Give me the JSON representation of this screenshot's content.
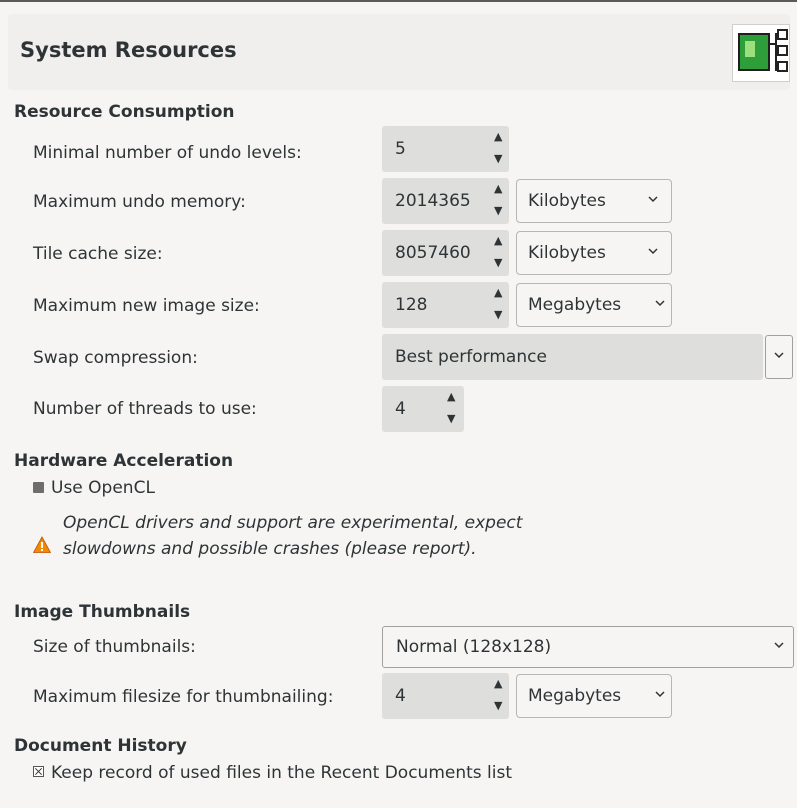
{
  "header": {
    "title": "System Resources",
    "icon": "system-resources-icon"
  },
  "resource_consumption": {
    "title": "Resource Consumption",
    "undo_levels": {
      "label": "Minimal number of undo levels:",
      "value": "5"
    },
    "undo_memory": {
      "label": "Maximum undo memory:",
      "value": "2014365",
      "unit": "Kilobytes"
    },
    "tile_cache": {
      "label": "Tile cache size:",
      "value": "8057460",
      "unit": "Kilobytes"
    },
    "new_image_size": {
      "label": "Maximum new image size:",
      "value": "128",
      "unit": "Megabytes"
    },
    "swap_compression": {
      "label": "Swap compression:",
      "value": "Best performance"
    },
    "threads": {
      "label": "Number of threads to use:",
      "value": "4"
    }
  },
  "hardware_acceleration": {
    "title": "Hardware Acceleration",
    "use_opencl": {
      "label": "Use OpenCL",
      "checked": false
    },
    "warning": "OpenCL drivers and support are experimental, expect slowdowns and possible crashes (please report)."
  },
  "image_thumbnails": {
    "title": "Image Thumbnails",
    "size": {
      "label": "Size of thumbnails:",
      "value": "Normal (128x128)"
    },
    "max_filesize": {
      "label": "Maximum filesize for thumbnailing:",
      "value": "4",
      "unit": "Megabytes"
    }
  },
  "document_history": {
    "title": "Document History",
    "keep_record": {
      "label": "Keep record of used files in the Recent Documents list",
      "checked": true
    }
  }
}
